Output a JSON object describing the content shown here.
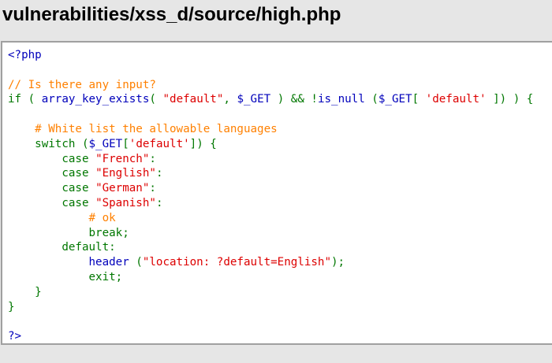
{
  "page": {
    "title": "vulnerabilities/xss_d/source/high.php"
  },
  "colors": {
    "keyword": "#007700",
    "default": "#0000bb",
    "string": "#dd0000",
    "comment": "#ff8000",
    "background": "#e6e6e6",
    "code_background": "#ffffff",
    "border": "#a0a0a0"
  },
  "code": {
    "open_tag": "<?php",
    "comment_input": "// Is there any input?",
    "if_keyword": "if ( ",
    "fn_array_key_exists": "array_key_exists",
    "paren_open": "( ",
    "str_default_dq": "\"default\"",
    "comma_space": ", ",
    "var_get": "$_GET",
    "and_not": " ) && !",
    "fn_is_null": "is_null",
    "is_null_open": " (",
    "bracket_open": "[ ",
    "str_default_sq": "'default'",
    "bracket_close_brace": " ]) ) {",
    "comment_whitelist": "# White list the allowable languages",
    "switch_open": "switch (",
    "bracket_l": "[",
    "switch_close": "]) {",
    "case_kw": "case ",
    "str_french": "\"French\"",
    "str_english": "\"English\"",
    "str_german": "\"German\"",
    "str_spanish": "\"Spanish\"",
    "colon": ":",
    "comment_ok": "# ok",
    "break_stmt": "break;",
    "default_label": "default:",
    "fn_header": "header",
    "header_open": " (",
    "str_location": "\"location: ?default=English\"",
    "header_close": ");",
    "exit_stmt": "exit;",
    "close_brace": "}",
    "close_tag": "?>"
  }
}
